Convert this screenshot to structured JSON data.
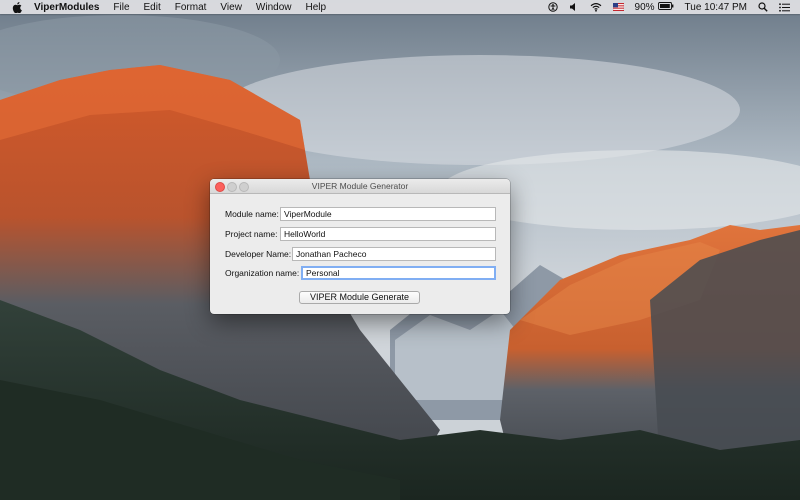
{
  "menubar": {
    "apple_icon": "apple-icon",
    "app_name": "ViperModules",
    "menus": [
      "File",
      "Edit",
      "Format",
      "View",
      "Window",
      "Help"
    ],
    "status": {
      "battery_percent": "90%",
      "clock": "Tue 10:47 PM"
    },
    "status_icons": [
      "accessibility-icon",
      "volume-icon",
      "wifi-icon",
      "flag-icon",
      "battery-icon",
      "search-icon",
      "list-icon"
    ]
  },
  "window": {
    "title": "VIPER Module Generator",
    "fields": {
      "module_name": {
        "label": "Module name:",
        "value": "ViperModule"
      },
      "project_name": {
        "label": "Project name:",
        "value": "HelloWorld"
      },
      "developer_name": {
        "label": "Developer Name:",
        "value": "Jonathan Pacheco"
      },
      "organization_name": {
        "label": "Organization name:",
        "value": "Personal"
      }
    },
    "generate_button": "VIPER Module Generate"
  },
  "colors": {
    "close_button": "#fc605c",
    "focus_ring": "#80aef3",
    "menubar": "#e1e1e4"
  }
}
